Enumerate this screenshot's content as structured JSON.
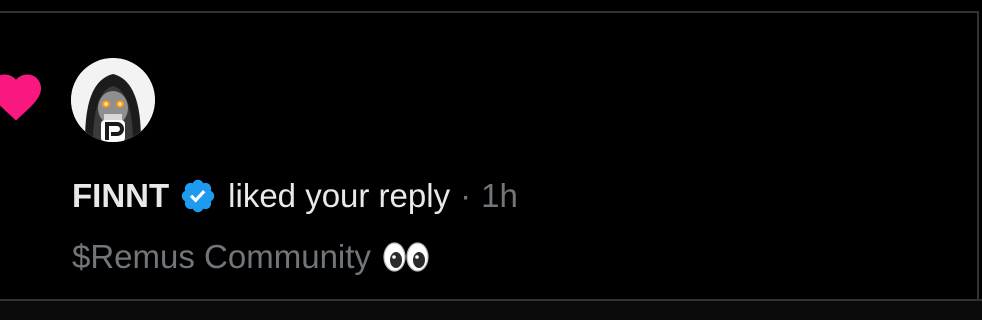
{
  "notification": {
    "icon": "heart-icon",
    "icon_color": "#f91880",
    "user": {
      "name": "FINNT",
      "verified": true,
      "verified_badge_color": "#1d9bf0",
      "avatar": "avatar"
    },
    "action": "liked your reply",
    "separator": "·",
    "time": "1h",
    "reply_excerpt": "$Remus Community",
    "reply_emoji": "eyes-emoji-icon"
  },
  "colors": {
    "background": "#000000",
    "primary_text": "#e7e9ea",
    "secondary_text": "#71767b",
    "divider": "#2f3336"
  }
}
